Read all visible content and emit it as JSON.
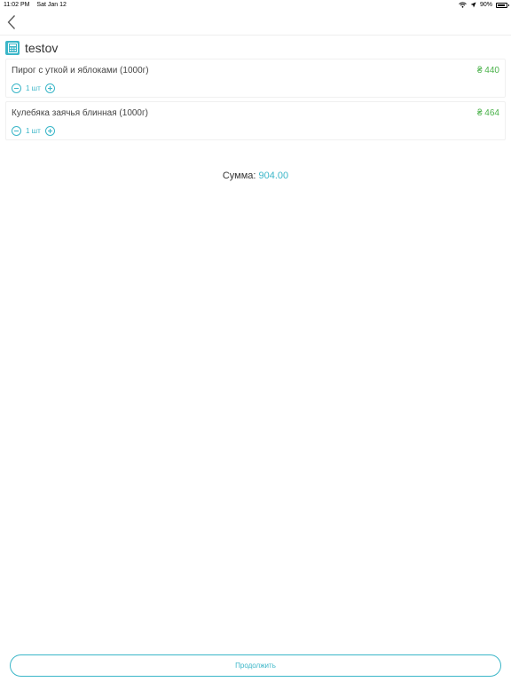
{
  "status_bar": {
    "time": "11:02 PM",
    "date": "Sat Jan 12",
    "battery": "90%",
    "battery_level": 0.9
  },
  "nav": {
    "back_icon": "chevron-left-icon"
  },
  "store": {
    "name": "testov",
    "icon": "calculator-icon"
  },
  "cart": {
    "items": [
      {
        "name": "Пирог с уткой и яблоками (1000г)",
        "price": "₴ 440",
        "quantity": "1 шт"
      },
      {
        "name": "Кулебяка заячья блинная (1000г)",
        "price": "₴ 464",
        "quantity": "1 шт"
      }
    ]
  },
  "summary": {
    "label": "Сумма:",
    "value": "904.00"
  },
  "actions": {
    "continue_label": "Продолжить"
  },
  "colors": {
    "accent": "#3bb6c8",
    "price": "#4ab24a"
  }
}
